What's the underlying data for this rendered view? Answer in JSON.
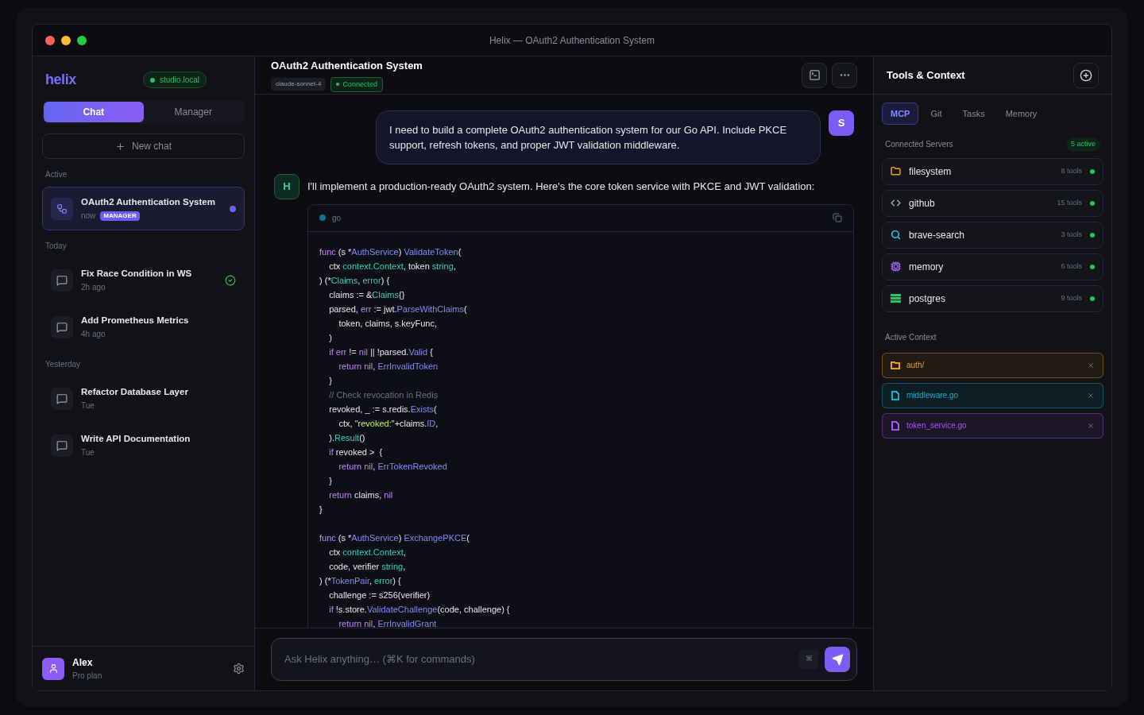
{
  "window": {
    "title": "Helix — OAuth2 Authentication System"
  },
  "sidebar": {
    "logo": "helix",
    "host_badge": "studio.local",
    "mode_tabs": [
      {
        "label": "Chat",
        "selected": true
      },
      {
        "label": "Manager",
        "selected": false
      }
    ],
    "new_chat": "New chat",
    "groups": [
      {
        "label": "Active",
        "items": [
          {
            "title": "OAuth2 Authentication System",
            "time": "now",
            "tag": "MANAGER",
            "kind": "manager",
            "selected": true,
            "done": false,
            "unread": true
          }
        ]
      },
      {
        "label": "Today",
        "items": [
          {
            "title": "Fix Race Condition in WS",
            "time": "2h ago",
            "kind": "chat",
            "selected": false,
            "done": true,
            "unread": false
          },
          {
            "title": "Add Prometheus Metrics",
            "time": "4h ago",
            "kind": "chat",
            "selected": false,
            "done": false,
            "unread": false
          }
        ]
      },
      {
        "label": "Yesterday",
        "items": [
          {
            "title": "Refactor Database Layer",
            "time": "Tue",
            "kind": "chat",
            "selected": false,
            "done": false,
            "unread": false
          },
          {
            "title": "Write API Documentation",
            "time": "Tue",
            "kind": "chat",
            "selected": false,
            "done": false,
            "unread": false
          }
        ]
      }
    ],
    "user": {
      "name": "Alex",
      "plan": "Pro plan"
    }
  },
  "chat": {
    "title": "OAuth2 Authentication System",
    "model": "claude-sonnet-4",
    "status": "Connected",
    "messages": [
      {
        "kind": "user",
        "avatar": "S",
        "text": "I need to build a complete OAuth2 authentication system for our Go API. Include PKCE support, refresh tokens, and proper JWT validation middleware."
      },
      {
        "kind": "assistant",
        "avatar": "H",
        "text": "I'll implement a production-ready OAuth2 system. Here's the core token service with PKCE and JWT validation:",
        "code": {
          "language": "go",
          "lines": [
            {
              "kind": "code",
              "tokens": [
                {
                  "kind": "kw",
                  "text": "func"
                },
                {
                  "kind": "plain",
                  "text": " (s *"
                },
                {
                  "kind": "fn",
                  "text": "AuthService"
                },
                {
                  "kind": "plain",
                  "text": ") "
                },
                {
                  "kind": "fn",
                  "text": "ValidateToken"
                },
                {
                  "kind": "plain",
                  "text": "("
                }
              ]
            },
            {
              "kind": "code",
              "tokens": [
                {
                  "kind": "plain",
                  "text": "    ctx "
                },
                {
                  "kind": "type",
                  "text": "context.Context"
                },
                {
                  "kind": "plain",
                  "text": ", token "
                },
                {
                  "kind": "type",
                  "text": "string"
                },
                {
                  "kind": "plain",
                  "text": ","
                }
              ]
            },
            {
              "kind": "code",
              "tokens": [
                {
                  "kind": "plain",
                  "text": ") (*"
                },
                {
                  "kind": "type",
                  "text": "Claims"
                },
                {
                  "kind": "plain",
                  "text": ", "
                },
                {
                  "kind": "type",
                  "text": "error"
                },
                {
                  "kind": "plain",
                  "text": ") {"
                }
              ]
            },
            {
              "kind": "code",
              "tokens": [
                {
                  "kind": "plain",
                  "text": "    claims := &"
                },
                {
                  "kind": "type",
                  "text": "Claims"
                },
                {
                  "kind": "plain",
                  "text": "{}"
                }
              ]
            },
            {
              "kind": "code",
              "tokens": [
                {
                  "kind": "plain",
                  "text": "    parsed, "
                },
                {
                  "kind": "kw",
                  "text": "err"
                },
                {
                  "kind": "plain",
                  "text": " := jwt."
                },
                {
                  "kind": "fn",
                  "text": "ParseWithClaims"
                },
                {
                  "kind": "plain",
                  "text": "("
                }
              ]
            },
            {
              "kind": "code",
              "tokens": [
                {
                  "kind": "plain",
                  "text": "        token, claims, s.keyFunc,"
                }
              ]
            },
            {
              "kind": "code",
              "tokens": [
                {
                  "kind": "plain",
                  "text": "    )"
                }
              ]
            },
            {
              "kind": "code",
              "tokens": [
                {
                  "kind": "kw",
                  "text": "    if err"
                },
                {
                  "kind": "plain",
                  "text": " != "
                },
                {
                  "kind": "kw",
                  "text": "nil"
                },
                {
                  "kind": "plain",
                  "text": " || !parsed."
                },
                {
                  "kind": "fn",
                  "text": "Valid"
                },
                {
                  "kind": "plain",
                  "text": " {"
                }
              ]
            },
            {
              "kind": "code",
              "tokens": [
                {
                  "kind": "kw",
                  "text": "        return nil"
                },
                {
                  "kind": "plain",
                  "text": ", "
                },
                {
                  "kind": "fn",
                  "text": "ErrInvalidToken"
                }
              ]
            },
            {
              "kind": "code",
              "tokens": [
                {
                  "kind": "plain",
                  "text": "    }"
                }
              ]
            },
            {
              "kind": "code",
              "tokens": [
                {
                  "kind": "comment",
                  "text": "    // Check revocation in Redis"
                }
              ]
            },
            {
              "kind": "code",
              "tokens": [
                {
                  "kind": "plain",
                  "text": "    revoked, _ := s.redis."
                },
                {
                  "kind": "fn",
                  "text": "Exists"
                },
                {
                  "kind": "plain",
                  "text": "("
                }
              ]
            },
            {
              "kind": "code",
              "tokens": [
                {
                  "kind": "plain",
                  "text": "        ctx, "
                },
                {
                  "kind": "string",
                  "text": "\"revoked:\""
                },
                {
                  "kind": "plain",
                  "text": "+claims."
                },
                {
                  "kind": "fn",
                  "text": "ID"
                },
                {
                  "kind": "plain",
                  "text": ","
                }
              ]
            },
            {
              "kind": "code",
              "tokens": [
                {
                  "kind": "plain",
                  "text": "    )."
                },
                {
                  "kind": "type",
                  "text": "Result"
                },
                {
                  "kind": "plain",
                  "text": "()"
                }
              ]
            },
            {
              "kind": "code",
              "tokens": [
                {
                  "kind": "kw",
                  "text": "    if"
                },
                {
                  "kind": "plain",
                  "text": " revoked >  {"
                }
              ]
            },
            {
              "kind": "code",
              "tokens": [
                {
                  "kind": "kw",
                  "text": "        return nil"
                },
                {
                  "kind": "plain",
                  "text": ", "
                },
                {
                  "kind": "fn",
                  "text": "ErrTokenRevoked"
                }
              ]
            },
            {
              "kind": "code",
              "tokens": [
                {
                  "kind": "plain",
                  "text": "    }"
                }
              ]
            },
            {
              "kind": "code",
              "tokens": [
                {
                  "kind": "kw",
                  "text": "    return"
                },
                {
                  "kind": "plain",
                  "text": " claims, "
                },
                {
                  "kind": "kw",
                  "text": "nil"
                }
              ]
            },
            {
              "kind": "code",
              "tokens": [
                {
                  "kind": "plain",
                  "text": "}"
                }
              ]
            },
            {
              "kind": "blank"
            },
            {
              "kind": "code",
              "tokens": [
                {
                  "kind": "kw",
                  "text": "func"
                },
                {
                  "kind": "plain",
                  "text": " (s *"
                },
                {
                  "kind": "fn",
                  "text": "AuthService"
                },
                {
                  "kind": "plain",
                  "text": ") "
                },
                {
                  "kind": "fn",
                  "text": "ExchangePKCE"
                },
                {
                  "kind": "plain",
                  "text": "("
                }
              ]
            },
            {
              "kind": "code",
              "tokens": [
                {
                  "kind": "plain",
                  "text": "    ctx "
                },
                {
                  "kind": "type",
                  "text": "context.Context"
                },
                {
                  "kind": "plain",
                  "text": ","
                }
              ]
            },
            {
              "kind": "code",
              "tokens": [
                {
                  "kind": "plain",
                  "text": "    code, verifier "
                },
                {
                  "kind": "type",
                  "text": "string"
                },
                {
                  "kind": "plain",
                  "text": ","
                }
              ]
            },
            {
              "kind": "code",
              "tokens": [
                {
                  "kind": "plain",
                  "text": ") (*"
                },
                {
                  "kind": "fn",
                  "text": "TokenPair"
                },
                {
                  "kind": "plain",
                  "text": ", "
                },
                {
                  "kind": "type",
                  "text": "error"
                },
                {
                  "kind": "plain",
                  "text": ") {"
                }
              ]
            },
            {
              "kind": "code",
              "tokens": [
                {
                  "kind": "plain",
                  "text": "    challenge := s256(verifier)"
                }
              ]
            },
            {
              "kind": "code",
              "tokens": [
                {
                  "kind": "kw",
                  "text": "    if"
                },
                {
                  "kind": "plain",
                  "text": " !s.store."
                },
                {
                  "kind": "fn",
                  "text": "ValidateChallenge"
                },
                {
                  "kind": "plain",
                  "text": "(code, challenge) {"
                }
              ]
            },
            {
              "kind": "code",
              "tokens": [
                {
                  "kind": "kw",
                  "text": "        return nil"
                },
                {
                  "kind": "plain",
                  "text": ", "
                },
                {
                  "kind": "fn",
                  "text": "ErrInvalidGrant"
                }
              ]
            }
          ]
        }
      }
    ],
    "input": {
      "placeholder": "Ask Helix anything… (⌘K for commands)",
      "shortcut": "⌘"
    }
  },
  "tools": {
    "title": "Tools & Context",
    "tabs": [
      {
        "label": "MCP",
        "selected": true
      },
      {
        "label": "Git",
        "selected": false
      },
      {
        "label": "Tasks",
        "selected": false
      },
      {
        "label": "Memory",
        "selected": false
      }
    ],
    "servers_label": "Connected Servers",
    "active_count": "5 active",
    "servers": [
      {
        "name": "filesystem",
        "tools": "8 tools",
        "kind": "folder",
        "color": "#f59e0b",
        "online": true
      },
      {
        "name": "github",
        "tools": "15 tools",
        "kind": "code",
        "color": "#9ca3af",
        "online": true
      },
      {
        "name": "brave-search",
        "tools": "3 tools",
        "kind": "search",
        "color": "#22d3ee",
        "online": true
      },
      {
        "name": "memory",
        "tools": "6 tools",
        "kind": "chip",
        "color": "#a855f7",
        "online": true
      },
      {
        "name": "postgres",
        "tools": "9 tools",
        "kind": "database",
        "color": "#22c55e",
        "online": true
      }
    ],
    "context_label": "Active Context",
    "context": [
      {
        "name": "auth/",
        "kind": "folder",
        "color": "#f59e0b"
      },
      {
        "name": "middleware.go",
        "kind": "file",
        "color": "#06b6d4"
      },
      {
        "name": "token_service.go",
        "kind": "file",
        "color": "#a855f7"
      }
    ]
  }
}
